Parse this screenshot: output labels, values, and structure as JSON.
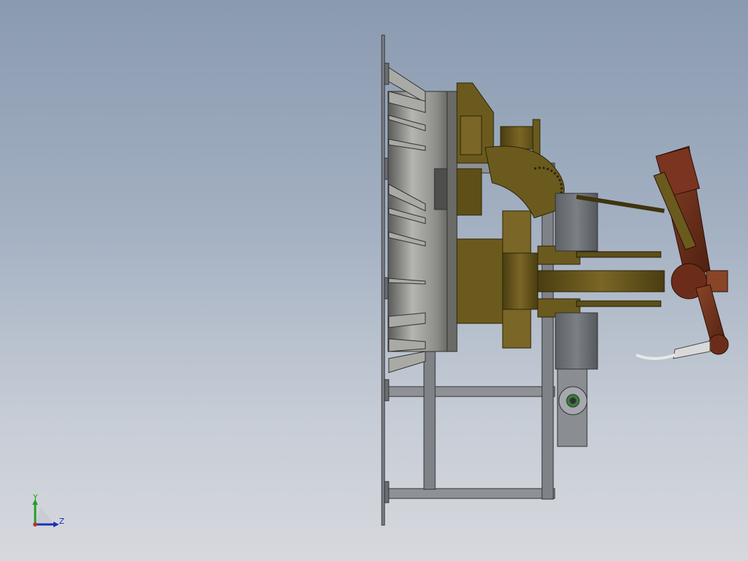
{
  "viewport": {
    "background_top": "#8a9ab0",
    "background_bottom": "#d6d8dd"
  },
  "colors": {
    "frame_steel": "#8c8f94",
    "frame_dark": "#5a5d62",
    "drum_light": "#b8b8b4",
    "drum_dark": "#4f504d",
    "robot_olive": "#6b5a1e",
    "robot_olive_dark": "#3f340e",
    "robot_olive_light": "#8c7630",
    "robot_rust": "#6b2d1a",
    "robot_rust_light": "#8a4428",
    "motor_gray": "#6e7175",
    "gear_green": "#3c7a3c",
    "torch_white": "#e8e8e8"
  },
  "triad": {
    "y_label": "Y",
    "z_label": "Z",
    "y_color": "#1fa01f",
    "z_color": "#1a2fb0",
    "origin_color": "#c03030"
  }
}
